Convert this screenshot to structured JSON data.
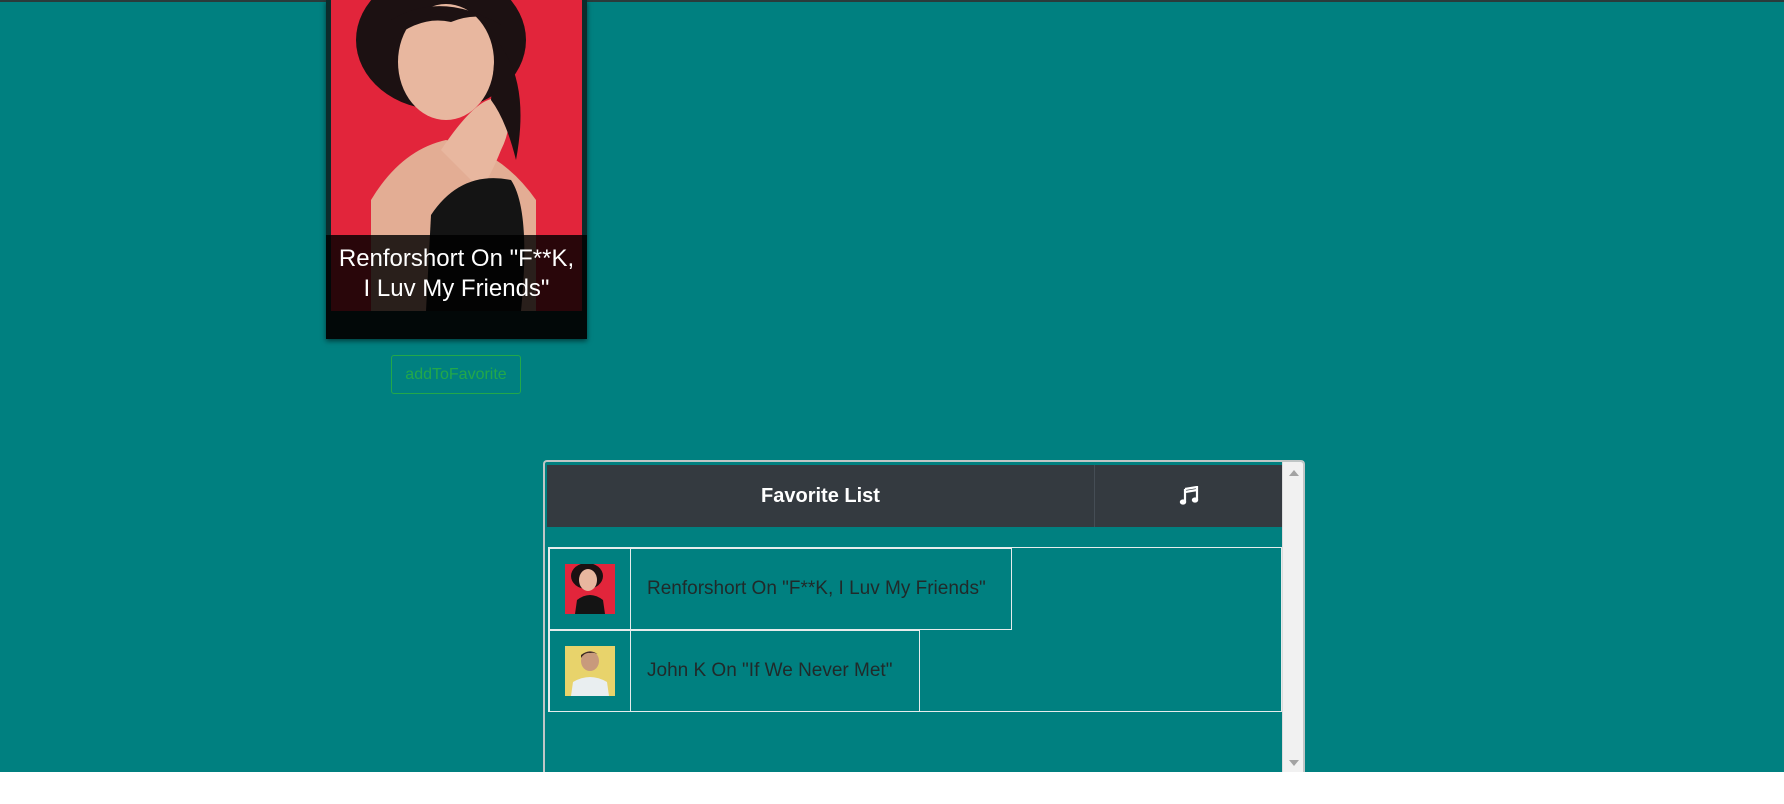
{
  "card": {
    "title": "Renforshort On \"F**K, I Luv My Friends\"",
    "button_label": "addToFavorite"
  },
  "favorites": {
    "header_title": "Favorite List",
    "header_icon": "music-note-icon",
    "items": [
      {
        "label": "Renforshort On \"F**K, I Luv My Friends\""
      },
      {
        "label": "John K On \"If We Never Met\""
      }
    ]
  },
  "colors": {
    "background": "#008080",
    "header_bg": "#343a40",
    "button_green": "#22a84a",
    "below_page": "#ffffff"
  }
}
